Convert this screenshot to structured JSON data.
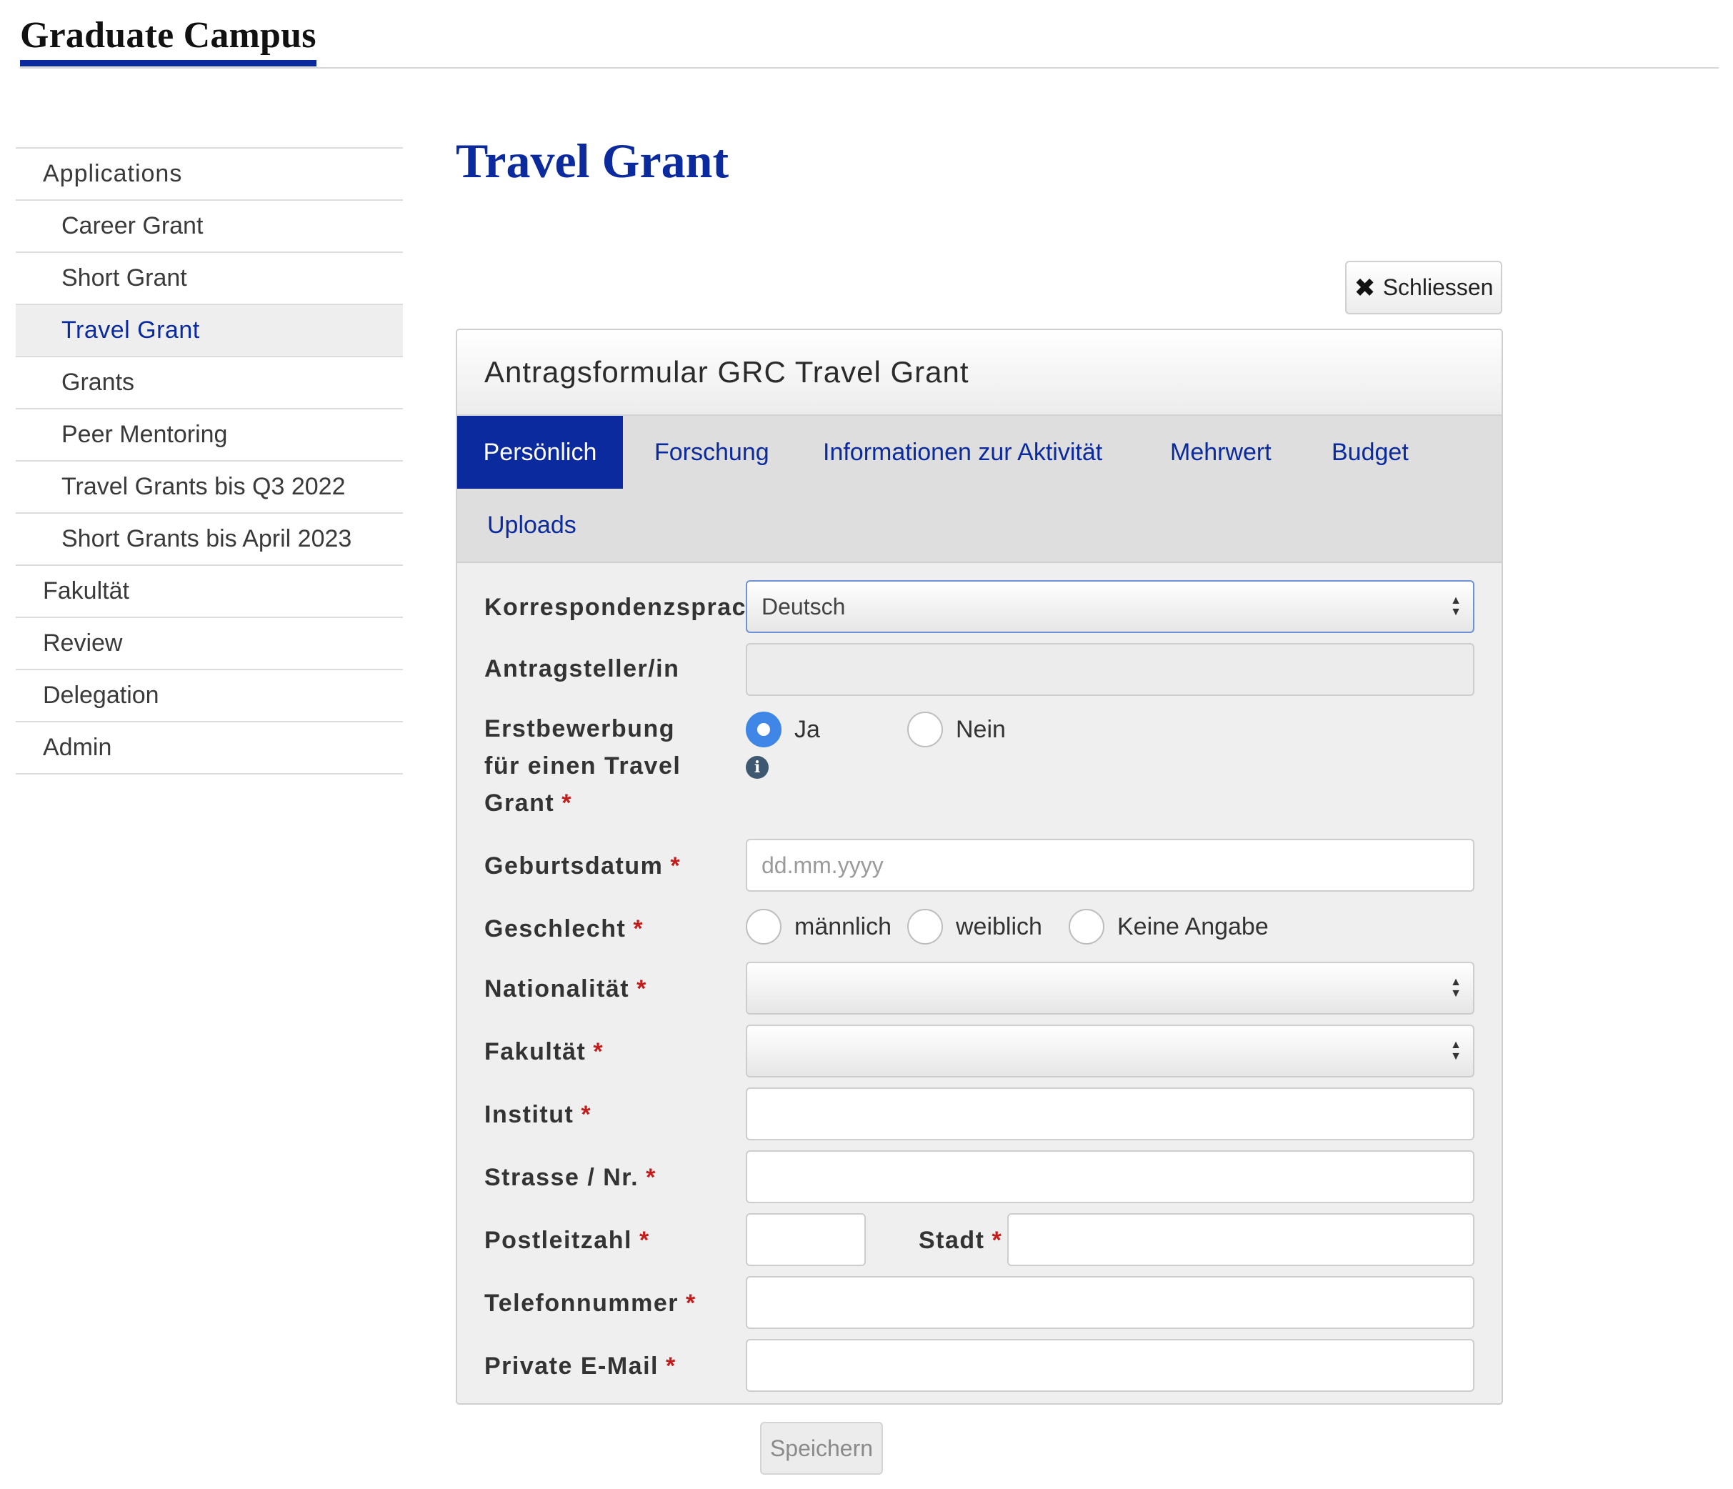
{
  "header": {
    "brand": "Graduate Campus"
  },
  "sidebar": {
    "items": [
      {
        "label": "Applications",
        "level": "top"
      },
      {
        "label": "Career Grant",
        "level": "sub"
      },
      {
        "label": "Short Grant",
        "level": "sub"
      },
      {
        "label": "Travel Grant",
        "level": "sub",
        "active": true
      },
      {
        "label": "Grants",
        "level": "sub"
      },
      {
        "label": "Peer Mentoring",
        "level": "sub"
      },
      {
        "label": "Travel Grants bis Q3 2022",
        "level": "sub"
      },
      {
        "label": "Short Grants bis April 2023",
        "level": "sub"
      },
      {
        "label": "Fakultät",
        "level": "top"
      },
      {
        "label": "Review",
        "level": "top"
      },
      {
        "label": "Delegation",
        "level": "top"
      },
      {
        "label": "Admin",
        "level": "top"
      }
    ]
  },
  "main": {
    "title": "Travel Grant",
    "close_label": "Schliessen",
    "close_icon": "close-icon",
    "panel_title": "Antragsformular GRC Travel Grant",
    "tabs": [
      {
        "label": "Persönlich",
        "active": true
      },
      {
        "label": "Forschung"
      },
      {
        "label": "Informationen zur Aktivität"
      },
      {
        "label": "Mehrwert"
      },
      {
        "label": "Budget"
      },
      {
        "label": "Uploads"
      }
    ],
    "save_label": "Speichern"
  },
  "form": {
    "required_marker": "*",
    "korrespondenz": {
      "label": "Korrespondenzsprach",
      "value": "Deutsch"
    },
    "antragsteller": {
      "label": "Antragsteller/in",
      "value": ""
    },
    "erstbewerbung": {
      "label_lines": [
        "Erstbewerbung",
        "für einen Travel",
        "Grant"
      ],
      "options": [
        {
          "label": "Ja",
          "checked": true
        },
        {
          "label": "Nein",
          "checked": false
        }
      ],
      "info_icon": "info-icon"
    },
    "geburtsdatum": {
      "label": "Geburtsdatum",
      "placeholder": "dd.mm.yyyy"
    },
    "geschlecht": {
      "label": "Geschlecht",
      "options": [
        {
          "label": "männlich",
          "checked": false
        },
        {
          "label": "weiblich",
          "checked": false
        },
        {
          "label": "Keine Angabe",
          "checked": false
        }
      ]
    },
    "nationalitaet": {
      "label": "Nationalität",
      "value": ""
    },
    "fakultaet": {
      "label": "Fakultät",
      "value": ""
    },
    "institut": {
      "label": "Institut",
      "value": ""
    },
    "strasse": {
      "label": "Strasse / Nr.",
      "value": ""
    },
    "postleitzahl": {
      "label": "Postleitzahl",
      "value": ""
    },
    "stadt": {
      "label": "Stadt",
      "value": ""
    },
    "telefon": {
      "label": "Telefonnummer",
      "value": ""
    },
    "email": {
      "label": "Private E-Mail",
      "value": ""
    }
  },
  "colors": {
    "brand": "#0b2a9e",
    "required": "#c21d1d",
    "radio_checked": "#3f86e6",
    "info_icon": "#3f5872"
  }
}
